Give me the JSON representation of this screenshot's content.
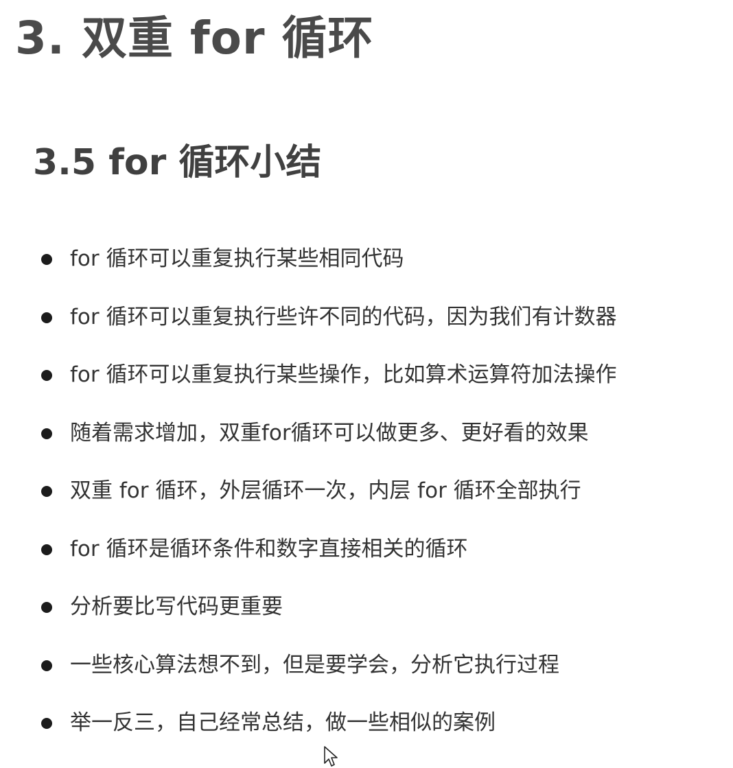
{
  "main_title": "3. 双重 for 循环",
  "section_title": "3.5 for 循环小结",
  "bullets": [
    "for 循环可以重复执行某些相同代码",
    "for 循环可以重复执行些许不同的代码，因为我们有计数器",
    "for 循环可以重复执行某些操作，比如算术运算符加法操作",
    "随着需求增加，双重for循环可以做更多、更好看的效果",
    "双重 for 循环，外层循环一次，内层 for 循环全部执行",
    "for 循环是循环条件和数字直接相关的循环",
    "分析要比写代码更重要",
    "一些核心算法想不到，但是要学会，分析它执行过程",
    "举一反三，自己经常总结，做一些相似的案例"
  ],
  "icons": {
    "bullet": "bullet-dot-icon",
    "cursor": "mouse-pointer-icon"
  }
}
